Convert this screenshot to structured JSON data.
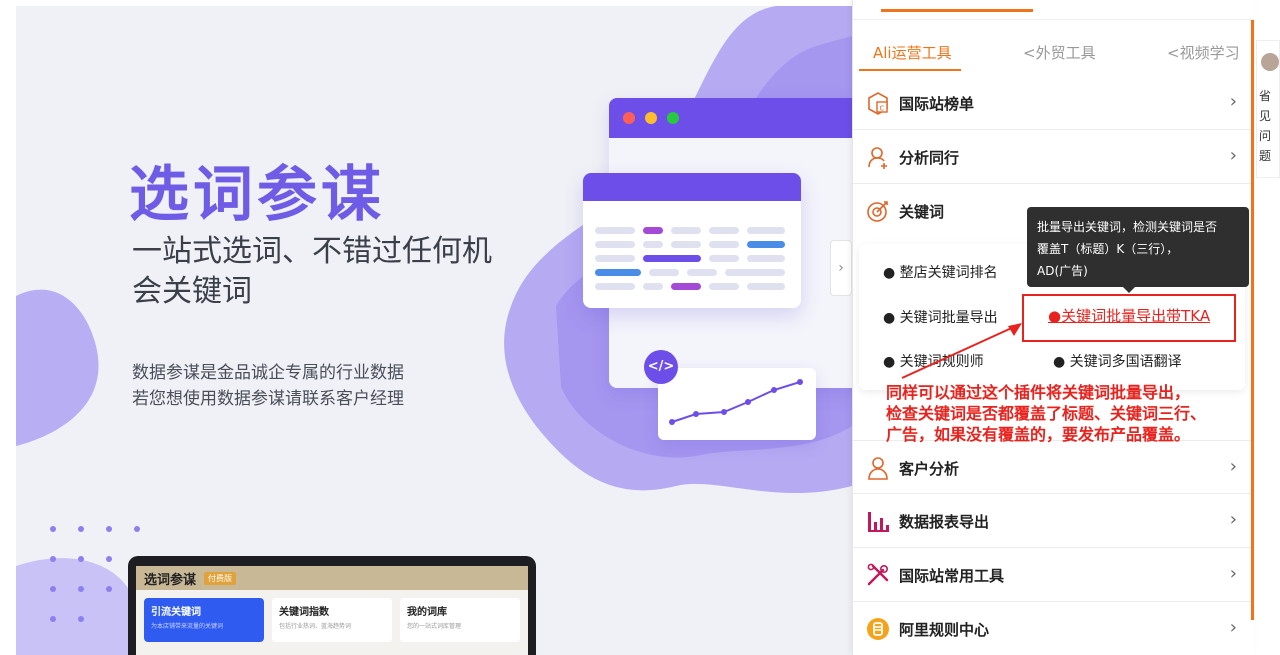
{
  "promo": {
    "title": "选词参谋",
    "subtitle": "一站式选词、不错过任何机会关键词",
    "desc_line1": "数据参谋是金品诚企专属的行业数据",
    "desc_line2": "若您想使用数据参谋请联系客户经理",
    "code_badge": "</>",
    "laptop": {
      "title": "选词参谋",
      "version": "付费版",
      "cards": [
        {
          "title": "引流关键词",
          "desc": "为本店铺带来流量的关键词"
        },
        {
          "title": "关键词指数",
          "desc": "包括行业热词、蓝海趋势词"
        },
        {
          "title": "我的词库",
          "desc": "您的一站式词库管理"
        }
      ]
    }
  },
  "panel": {
    "tabs": [
      "Ali运营工具",
      "<外贸工具",
      "<视频学习"
    ],
    "rows": [
      {
        "label": "国际站榜单",
        "icon": "box-icon"
      },
      {
        "label": "分析同行",
        "icon": "person-plus-icon"
      },
      {
        "label": "关键词",
        "icon": "target-icon"
      },
      {
        "label": "客户分析",
        "icon": "user-icon"
      },
      {
        "label": "数据报表导出",
        "icon": "bar-chart-icon"
      },
      {
        "label": "国际站常用工具",
        "icon": "tools-icon"
      },
      {
        "label": "阿里规则中心",
        "icon": "badge-icon"
      }
    ],
    "keyword_items": {
      "rank": "● 整店关键词排名",
      "export": "● 关键词批量导出",
      "export_tka": "●关键词批量导出带TKA",
      "rules": "● 关键词规则师",
      "translate": "● 关键词多国语翻译"
    },
    "tooltip": {
      "line1": "批量导出关键词，检测关键词是否",
      "line2": "覆盖T（标题）K（三行），",
      "line3": "AD(广告)"
    },
    "annotation": {
      "line1": "同样可以通过这个插件将关键词批量导出，",
      "line2": "检查关键词是否都覆盖了标题、关键词三行、",
      "line3": "广告，如果没有覆盖的，要发布产品覆盖。"
    },
    "chevron": "›",
    "side_arrow": "›"
  },
  "sliver": {
    "chars": [
      "省",
      "见",
      "问",
      "题"
    ]
  },
  "colors": {
    "accent": "#f0741a",
    "brand_purple": "#6d4ee8",
    "annotation_red": "#e8231e"
  }
}
